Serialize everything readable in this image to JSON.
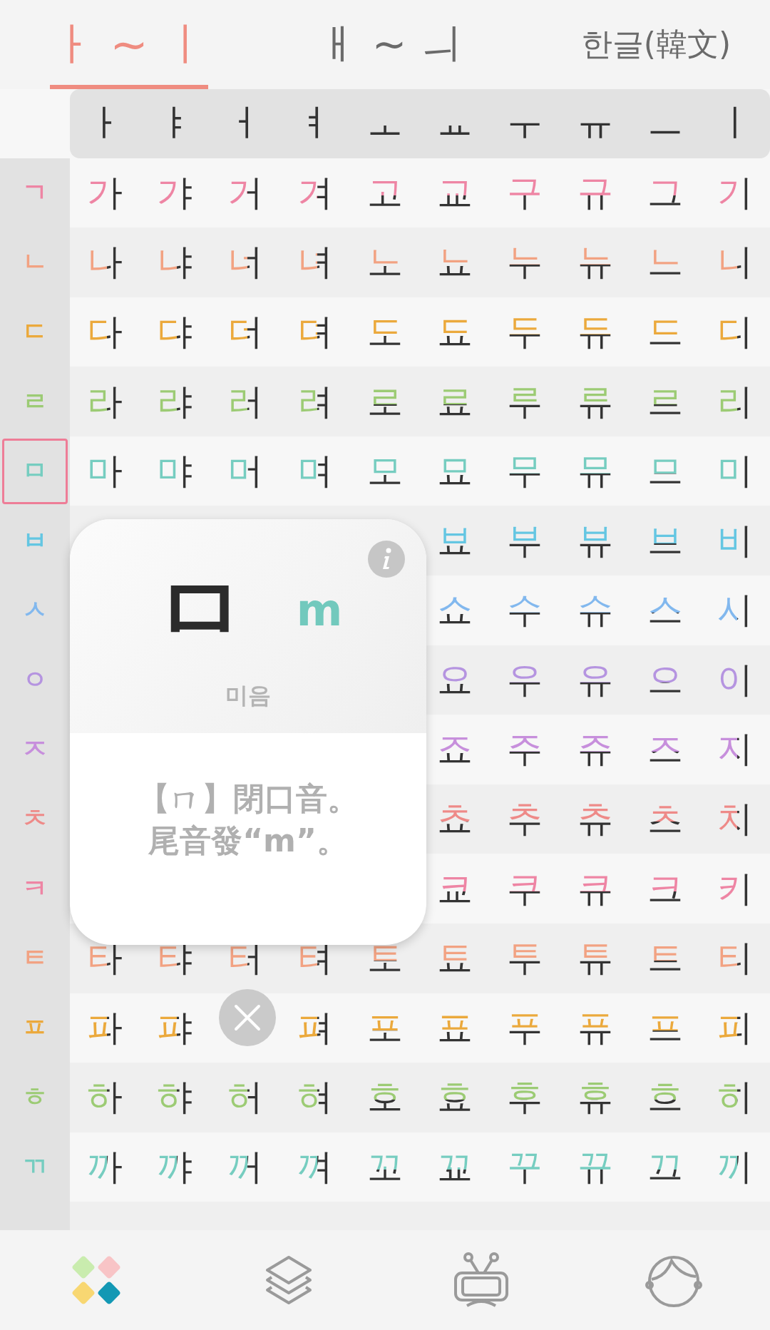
{
  "tabs": [
    {
      "label": "ㅏ ~ ㅣ",
      "selected": true
    },
    {
      "label": "ㅐ ~ ㅢ",
      "selected": false
    },
    {
      "label": "한글(韓文)",
      "selected": false
    }
  ],
  "vowels": [
    {
      "label": "ㅏ",
      "kind": "vertical"
    },
    {
      "label": "ㅑ",
      "kind": "vertical"
    },
    {
      "label": "ㅓ",
      "kind": "vertical"
    },
    {
      "label": "ㅕ",
      "kind": "vertical"
    },
    {
      "label": "ㅗ",
      "kind": "horizontal"
    },
    {
      "label": "ㅛ",
      "kind": "horizontal"
    },
    {
      "label": "ㅜ",
      "kind": "horizontal"
    },
    {
      "label": "ㅠ",
      "kind": "horizontal"
    },
    {
      "label": "ㅡ",
      "kind": "horizontal"
    },
    {
      "label": "ㅣ",
      "kind": "vertical"
    }
  ],
  "rows": [
    {
      "consonant": "ㄱ",
      "color": "#ee85a4",
      "selected": false,
      "cells": [
        "가",
        "갸",
        "거",
        "겨",
        "고",
        "교",
        "구",
        "규",
        "그",
        "기"
      ]
    },
    {
      "consonant": "ㄴ",
      "color": "#f2a282",
      "selected": false,
      "cells": [
        "나",
        "냐",
        "너",
        "녀",
        "노",
        "뇨",
        "누",
        "뉴",
        "느",
        "니"
      ]
    },
    {
      "consonant": "ㄷ",
      "color": "#eba93c",
      "selected": false,
      "cells": [
        "다",
        "댜",
        "더",
        "뎌",
        "도",
        "됴",
        "두",
        "듀",
        "드",
        "디"
      ]
    },
    {
      "consonant": "ㄹ",
      "color": "#9ccb74",
      "selected": false,
      "cells": [
        "라",
        "랴",
        "러",
        "려",
        "로",
        "료",
        "루",
        "류",
        "르",
        "리"
      ]
    },
    {
      "consonant": "ㅁ",
      "color": "#76cdc0",
      "selected": true,
      "cells": [
        "마",
        "먀",
        "머",
        "며",
        "모",
        "묘",
        "무",
        "뮤",
        "므",
        "미"
      ]
    },
    {
      "consonant": "ㅂ",
      "color": "#64c6e2",
      "selected": false,
      "cells": [
        null,
        null,
        null,
        null,
        null,
        "뵤",
        "부",
        "뷰",
        "브",
        "비"
      ]
    },
    {
      "consonant": "ㅅ",
      "color": "#82b8ee",
      "selected": false,
      "cells": [
        null,
        null,
        null,
        null,
        null,
        "쇼",
        "수",
        "슈",
        "스",
        "시"
      ]
    },
    {
      "consonant": "ㅇ",
      "color": "#b594e0",
      "selected": false,
      "cells": [
        null,
        null,
        null,
        null,
        null,
        "요",
        "우",
        "유",
        "으",
        "이"
      ]
    },
    {
      "consonant": "ㅈ",
      "color": "#c78fdc",
      "selected": false,
      "cells": [
        null,
        null,
        null,
        null,
        null,
        "죠",
        "주",
        "쥬",
        "즈",
        "지"
      ]
    },
    {
      "consonant": "ㅊ",
      "color": "#ee8a88",
      "selected": false,
      "cells": [
        null,
        null,
        null,
        null,
        null,
        "쵸",
        "추",
        "츄",
        "츠",
        "치"
      ]
    },
    {
      "consonant": "ㅋ",
      "color": "#ee85a4",
      "selected": false,
      "cells": [
        null,
        null,
        null,
        null,
        null,
        "쿄",
        "쿠",
        "큐",
        "크",
        "키"
      ]
    },
    {
      "consonant": "ㅌ",
      "color": "#f2a282",
      "selected": false,
      "cells": [
        "타",
        "탸",
        "터",
        "텨",
        "토",
        "툐",
        "투",
        "튜",
        "트",
        "티"
      ]
    },
    {
      "consonant": "ㅍ",
      "color": "#eba93c",
      "selected": false,
      "cells": [
        "파",
        "퍄",
        null,
        "펴",
        "포",
        "표",
        "푸",
        "퓨",
        "프",
        "피"
      ]
    },
    {
      "consonant": "ㅎ",
      "color": "#9ccb74",
      "selected": false,
      "cells": [
        "하",
        "햐",
        "허",
        "혀",
        "호",
        "효",
        "후",
        "휴",
        "흐",
        "히"
      ]
    },
    {
      "consonant": "ㄲ",
      "color": "#76cdc0",
      "selected": false,
      "cells": [
        "까",
        "꺄",
        "꺼",
        "껴",
        "꼬",
        "꾜",
        "꾸",
        "뀨",
        "끄",
        "끼"
      ]
    }
  ],
  "popup": {
    "letter": "ㅁ",
    "romanization": "m",
    "name": "미음",
    "description": [
      "【ㄇ】閉口音。",
      "尾音發“m”。"
    ]
  },
  "nav": [
    {
      "kind": "tiles",
      "selected": true
    },
    {
      "kind": "layers",
      "selected": false
    },
    {
      "kind": "tv",
      "selected": false
    },
    {
      "kind": "head",
      "selected": false
    }
  ]
}
